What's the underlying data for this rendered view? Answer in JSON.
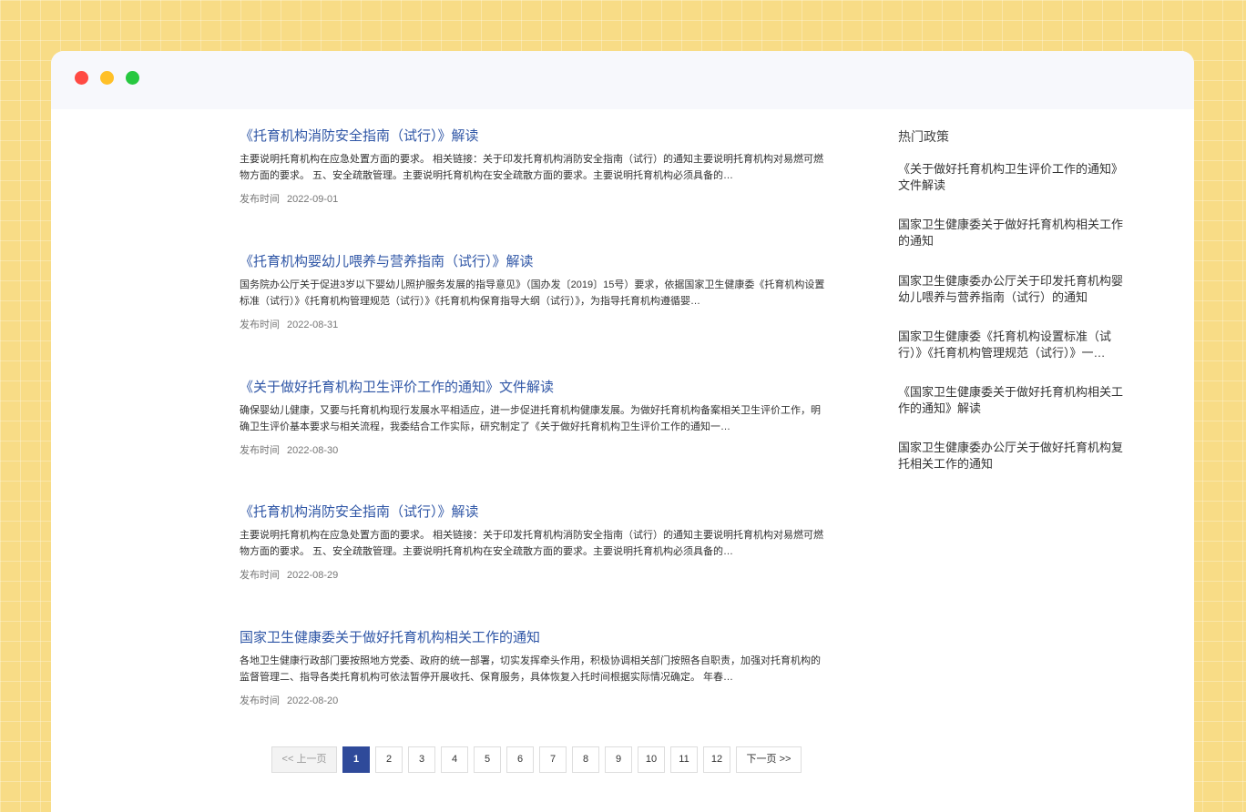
{
  "articles": [
    {
      "title": "《托育机构消防安全指南（试行）》解读",
      "summary": "主要说明托育机构在应急处置方面的要求。 相关链接：关于印发托育机构消防安全指南（试行）的通知主要说明托育机构对易燃可燃物方面的要求。 五、安全疏散管理。主要说明托育机构在安全疏散方面的要求。主要说明托育机构必须具备的…",
      "date_label": "发布时间",
      "date": "2022-09-01"
    },
    {
      "title": "《托育机构婴幼儿喂养与营养指南（试行）》解读",
      "summary": "国务院办公厅关于促进3岁以下婴幼儿照护服务发展的指导意见》（国办发〔2019〕15号）要求，依据国家卫生健康委《托育机构设置标准（试行）》《托育机构管理规范（试行）》《托育机构保育指导大纲（试行）》，为指导托育机构遵循婴…",
      "date_label": "发布时间",
      "date": "2022-08-31"
    },
    {
      "title": "《关于做好托育机构卫生评价工作的通知》文件解读",
      "summary": "确保婴幼儿健康，又要与托育机构现行发展水平相适应，进一步促进托育机构健康发展。为做好托育机构备案相关卫生评价工作，明确卫生评价基本要求与相关流程，我委结合工作实际，研究制定了《关于做好托育机构卫生评价工作的通知一…",
      "date_label": "发布时间",
      "date": "2022-08-30"
    },
    {
      "title": "《托育机构消防安全指南（试行）》解读",
      "summary": "主要说明托育机构在应急处置方面的要求。 相关链接：关于印发托育机构消防安全指南（试行）的通知主要说明托育机构对易燃可燃物方面的要求。 五、安全疏散管理。主要说明托育机构在安全疏散方面的要求。主要说明托育机构必须具备的…",
      "date_label": "发布时间",
      "date": "2022-08-29"
    },
    {
      "title": "国家卫生健康委关于做好托育机构相关工作的通知",
      "summary": "各地卫生健康行政部门要按照地方党委、政府的统一部署，切实发挥牵头作用，积极协调相关部门按照各自职责，加强对托育机构的监督管理二、指导各类托育机构可依法暂停开展收托、保育服务，具体恢复入托时间根据实际情况确定。 年春…",
      "date_label": "发布时间",
      "date": "2022-08-20"
    }
  ],
  "sidebar": {
    "title": "热门政策",
    "items": [
      "《关于做好托育机构卫生评价工作的通知》文件解读",
      "国家卫生健康委关于做好托育机构相关工作的通知",
      "国家卫生健康委办公厅关于印发托育机构婴幼儿喂养与营养指南（试行）的通知",
      "国家卫生健康委《托育机构设置标准（试行）》《托育机构管理规范（试行）》一…",
      "《国家卫生健康委关于做好托育机构相关工作的通知》解读",
      "国家卫生健康委办公厅关于做好托育机构复托相关工作的通知"
    ]
  },
  "pagination": {
    "prev": "<< 上一页",
    "next": "下一页 >>",
    "pages": [
      "1",
      "2",
      "3",
      "4",
      "5",
      "6",
      "7",
      "8",
      "9",
      "10",
      "11",
      "12"
    ],
    "current": "1"
  },
  "colors": {
    "background": "#f8dc86",
    "link": "#2f56a6",
    "active_page": "#2f4a9a",
    "traffic_red": "#ff4a43",
    "traffic_yellow": "#ffc028",
    "traffic_green": "#27c840"
  }
}
